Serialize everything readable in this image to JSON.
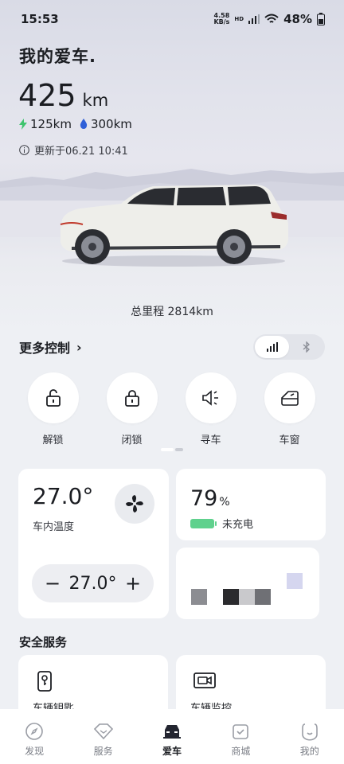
{
  "status_bar": {
    "time": "15:53",
    "net_speed_value": "4.58",
    "net_speed_unit": "KB/s",
    "hd_label": "HD",
    "battery_percent": "48%"
  },
  "header": {
    "title": "我的爱车."
  },
  "range": {
    "total_value": "425",
    "total_unit": "km",
    "electric": "125km",
    "fuel": "300km",
    "updated": "更新于06.21 10:41"
  },
  "odometer": "总里程 2814km",
  "more_controls": {
    "label": "更多控制",
    "chevron": "›"
  },
  "quick_controls": [
    {
      "label": "解锁",
      "icon": "unlock-icon"
    },
    {
      "label": "闭锁",
      "icon": "lock-icon"
    },
    {
      "label": "寻车",
      "icon": "find-car-icon"
    },
    {
      "label": "车窗",
      "icon": "window-icon"
    }
  ],
  "climate": {
    "temperature": "27.0°",
    "caption": "车内温度",
    "set_temperature": "27.0°",
    "minus": "−",
    "plus": "+"
  },
  "battery": {
    "percent": "79",
    "percent_unit": "%",
    "charge_state": "未充电",
    "level": 0.79
  },
  "safety": {
    "section_title": "安全服务",
    "items": [
      {
        "label": "车辆钥匙",
        "icon": "car-key-icon"
      },
      {
        "label": "车辆监控",
        "icon": "camera-monitor-icon"
      }
    ]
  },
  "tabbar": {
    "items": [
      {
        "label": "发现",
        "icon": "compass-icon"
      },
      {
        "label": "服务",
        "icon": "service-heart-icon"
      },
      {
        "label": "爱车",
        "icon": "car-icon"
      },
      {
        "label": "商城",
        "icon": "shop-icon"
      },
      {
        "label": "我的",
        "icon": "profile-icon"
      }
    ],
    "active": "爱车"
  },
  "colors": {
    "electric_green": "#3fc46e",
    "fuel_blue": "#2f5fd8",
    "battery_green": "#5fd18d",
    "active_tab": "#1b1d22",
    "inactive_tab": "#7a7d85"
  }
}
